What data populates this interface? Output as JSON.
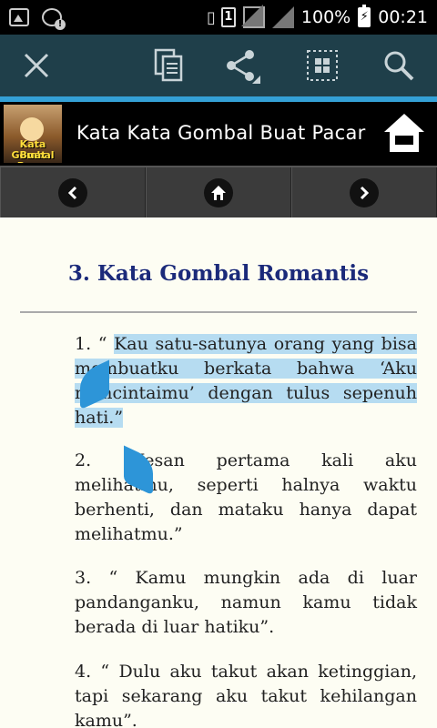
{
  "status_bar": {
    "battery": "100%",
    "time": "00:21",
    "sim_slot": "1"
  },
  "action_bar": {
    "icons": [
      "close-icon",
      "copy-icon",
      "share-icon",
      "select-all-icon",
      "search-icon"
    ]
  },
  "app_header": {
    "logo_line1": "Kata Gombal",
    "logo_line2": "Buat Pacar",
    "title": "Kata Kata Gombal Buat Pacar"
  },
  "content": {
    "heading": "3. Kata Gombal Romantis",
    "items": [
      {
        "prefix": "1. “ ",
        "selected_text": "Kau satu-satunya orang yang bisa membuatku berkata bahwa ‘Aku mencintaimu’ dengan tulus sepenuh hati.”",
        "text": ""
      },
      {
        "prefix": "2. “",
        "selected_text": "",
        "text": "Kesan pertama kali aku melihatmu, seperti halnya waktu berhenti, dan mataku hanya dapat melihatmu.”"
      },
      {
        "prefix": "3. “ ",
        "selected_text": "",
        "text": "Kamu mungkin ada di luar pandanganku, namun kamu tidak berada di luar hatiku”."
      },
      {
        "prefix": "4. “ ",
        "selected_text": "",
        "text": "Dulu aku takut akan ketinggian, tapi sekarang aku takut kehilangan kamu”."
      }
    ]
  },
  "colors": {
    "action_bar": "#1f3f4a",
    "accent": "#34a0d6",
    "heading": "#1b2a7a",
    "selection": "#b6dcf1",
    "handle": "#2d95d8"
  }
}
